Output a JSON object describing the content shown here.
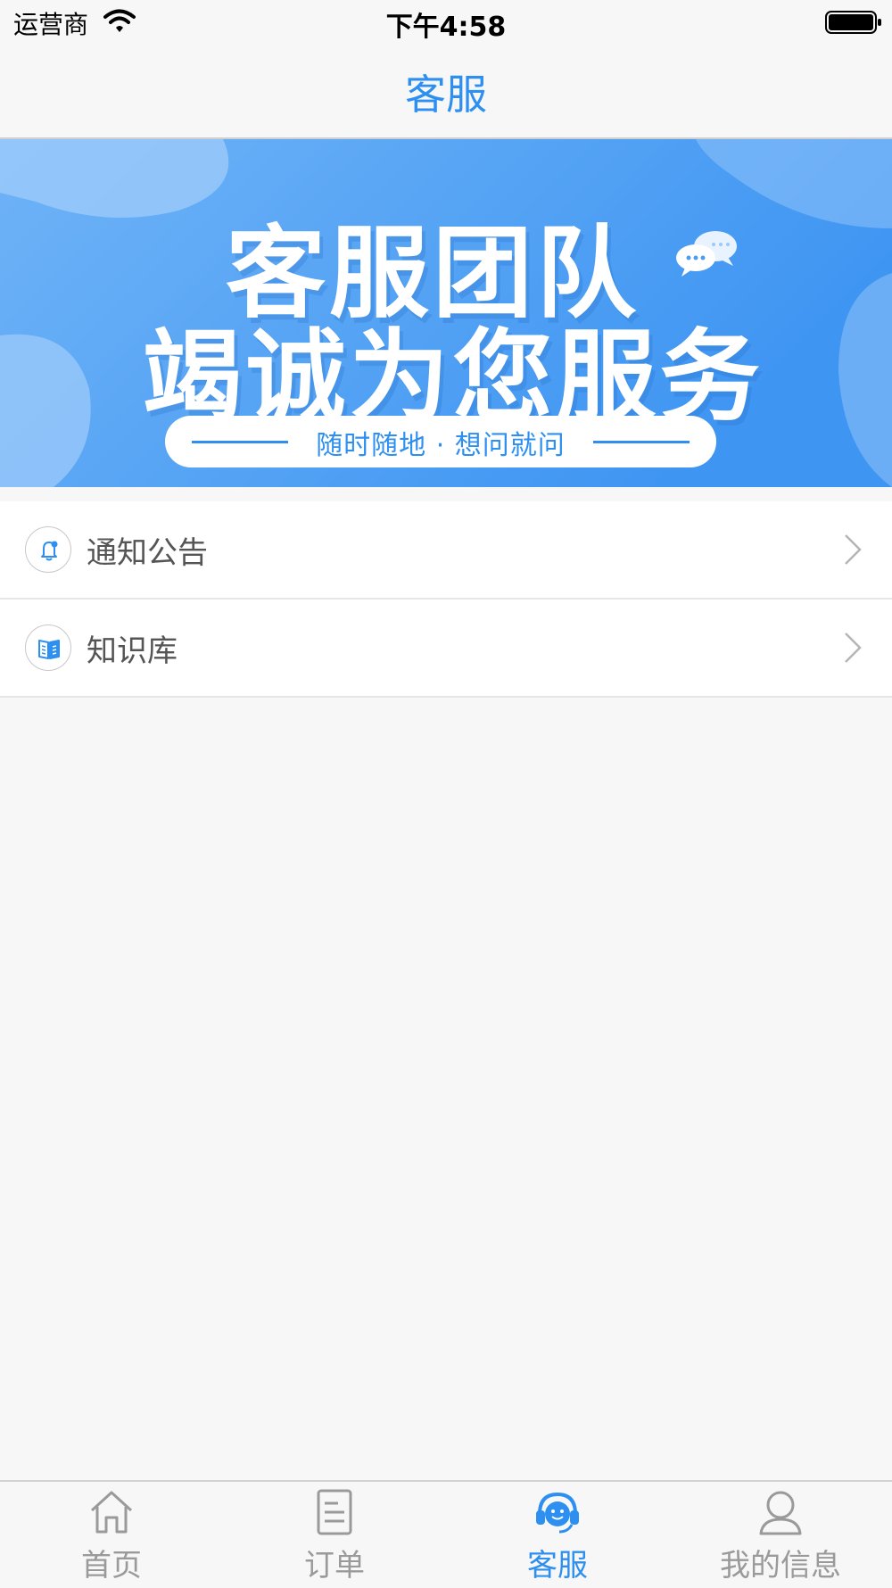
{
  "status_bar": {
    "carrier": "运营商",
    "time": "下午4:58"
  },
  "nav": {
    "title": "客服"
  },
  "banner": {
    "headline_line1": "客服团队",
    "headline_line2": "竭诚为您服务",
    "tagline": "随时随地 · 想问就问"
  },
  "menu": {
    "items": [
      {
        "label": "通知公告",
        "icon": "bell-icon"
      },
      {
        "label": "知识库",
        "icon": "book-icon"
      }
    ]
  },
  "tab_bar": {
    "items": [
      {
        "label": "首页",
        "icon": "home-icon",
        "active": false
      },
      {
        "label": "订单",
        "icon": "document-icon",
        "active": false
      },
      {
        "label": "客服",
        "icon": "headset-icon",
        "active": true
      },
      {
        "label": "我的信息",
        "icon": "person-icon",
        "active": false
      }
    ]
  },
  "colors": {
    "accent": "#2d8ff0",
    "inactive": "#9a9a9a",
    "banner_blue": "#4a9df5"
  }
}
